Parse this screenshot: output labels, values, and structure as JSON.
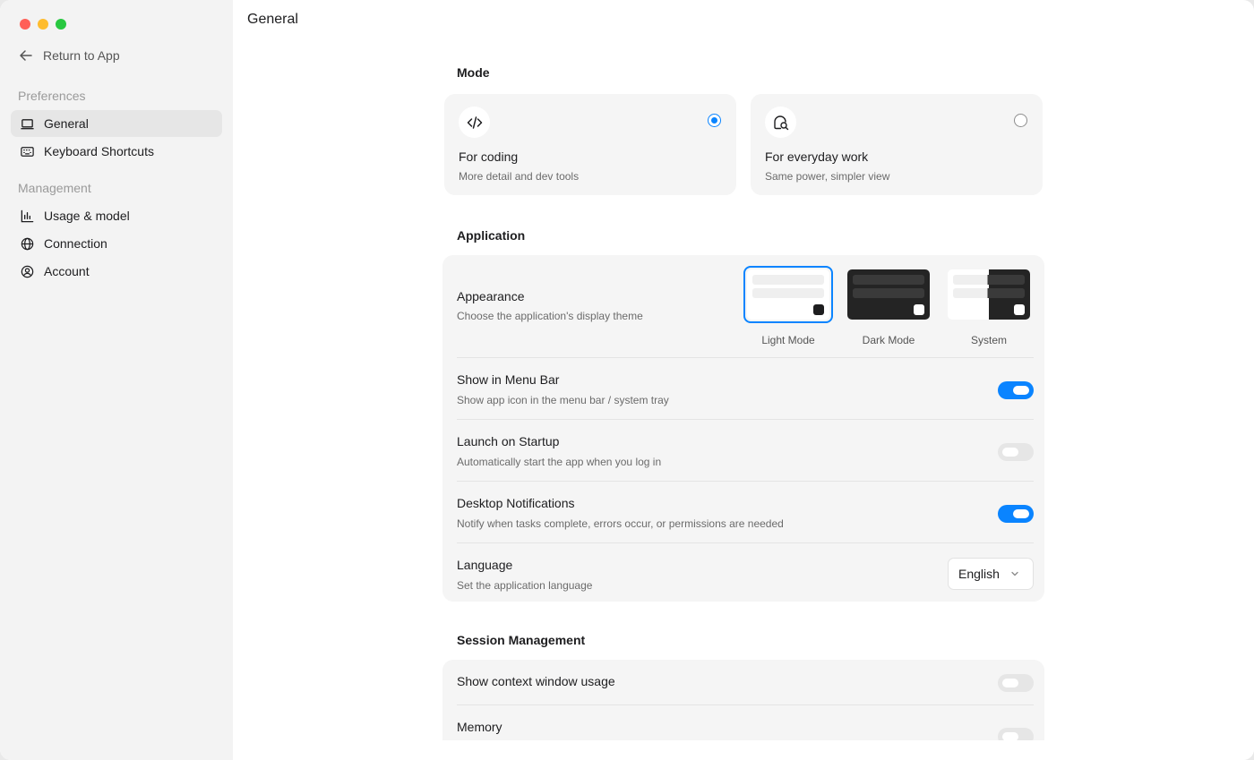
{
  "sidebar": {
    "return_label": "Return to App",
    "sections": [
      {
        "label": "Preferences"
      },
      {
        "label": "Management"
      }
    ],
    "items": [
      {
        "label": "General",
        "icon": "laptop-icon"
      },
      {
        "label": "Keyboard Shortcuts",
        "icon": "keyboard-icon"
      },
      {
        "label": "Usage & model",
        "icon": "bar-chart-icon"
      },
      {
        "label": "Connection",
        "icon": "globe-icon"
      },
      {
        "label": "Account",
        "icon": "user-circle-icon"
      }
    ]
  },
  "main": {
    "title": "General",
    "mode": {
      "heading": "Mode",
      "options": [
        {
          "title": "For coding",
          "desc": "More detail and dev tools",
          "selected": true,
          "icon": "code-icon"
        },
        {
          "title": "For everyday work",
          "desc": "Same power, simpler view",
          "selected": false,
          "icon": "chat-search-icon"
        }
      ]
    },
    "application": {
      "heading": "Application",
      "appearance": {
        "title": "Appearance",
        "desc": "Choose the application's display theme",
        "options": [
          "Light Mode",
          "Dark Mode",
          "System"
        ],
        "selected": "Light Mode"
      },
      "menu_bar": {
        "title": "Show in Menu Bar",
        "desc": "Show app icon in the menu bar / system tray",
        "on": true
      },
      "startup": {
        "title": "Launch on Startup",
        "desc": "Automatically start the app when you log in",
        "on": false
      },
      "notifications": {
        "title": "Desktop Notifications",
        "desc": "Notify when tasks complete, errors occur, or permissions are needed",
        "on": true
      },
      "language": {
        "title": "Language",
        "desc": "Set the application language",
        "value": "English"
      }
    },
    "session": {
      "heading": "Session Management",
      "context_usage": {
        "title": "Show context window usage",
        "on": false
      },
      "memory": {
        "title": "Memory",
        "on": false
      }
    }
  },
  "colors": {
    "accent": "#0a84ff",
    "sidebar_bg": "#f3f3f3",
    "panel_bg": "#f5f5f5"
  }
}
